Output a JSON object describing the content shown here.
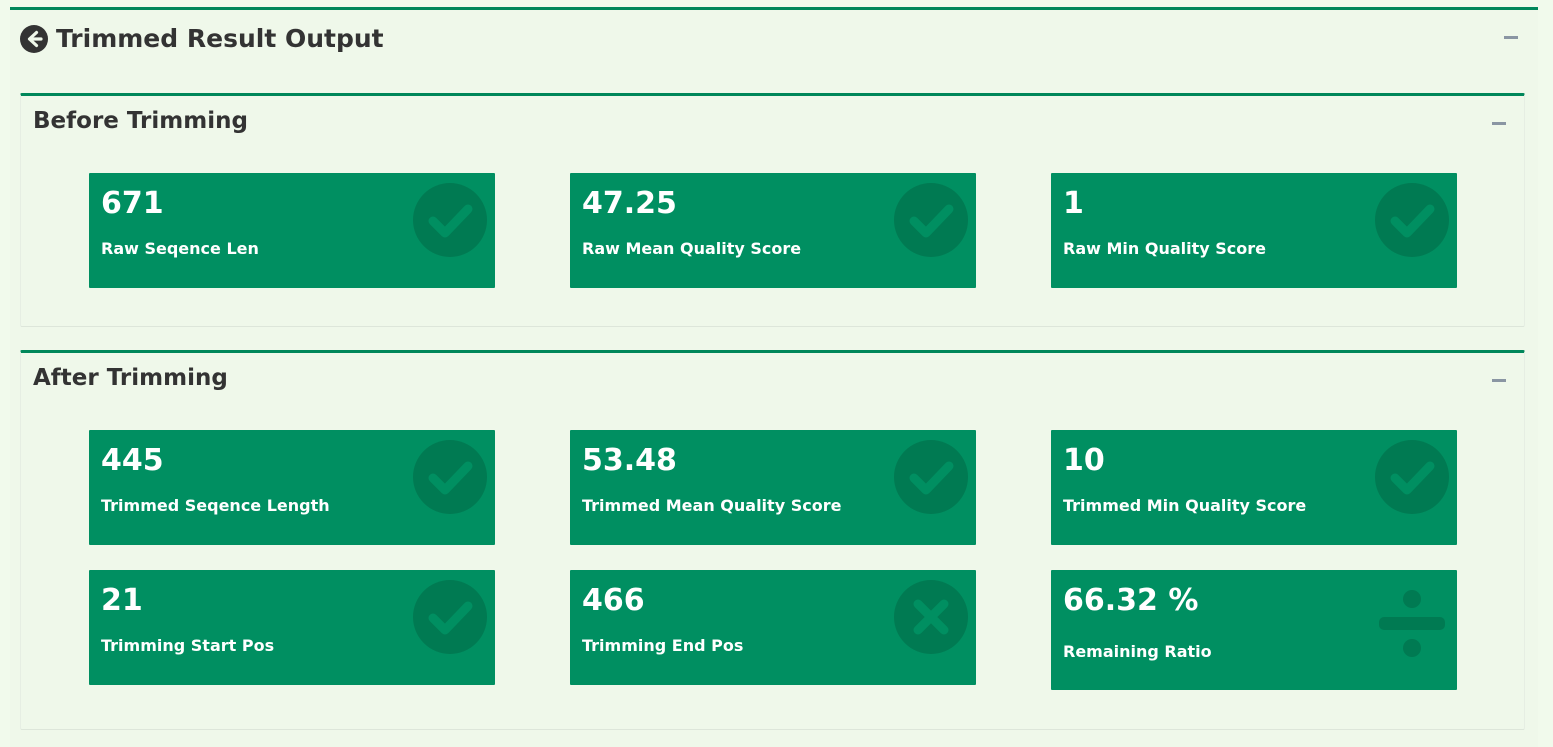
{
  "panel": {
    "title": "Trimmed Result Output",
    "back_icon": "arrow-circle-left-icon"
  },
  "before": {
    "title": "Before Trimming",
    "cards": [
      {
        "value": "671",
        "label": "Raw Seqence Len",
        "icon": "check-circle-icon"
      },
      {
        "value": "47.25",
        "label": "Raw Mean Quality Score",
        "icon": "check-circle-icon"
      },
      {
        "value": "1",
        "label": "Raw Min Quality Score",
        "icon": "check-circle-icon"
      }
    ]
  },
  "after": {
    "title": "After Trimming",
    "cards": [
      {
        "value": "445",
        "label": "Trimmed Seqence Length",
        "icon": "check-circle-icon"
      },
      {
        "value": "53.48",
        "label": "Trimmed Mean Quality Score",
        "icon": "check-circle-icon"
      },
      {
        "value": "10",
        "label": "Trimmed Min Quality Score",
        "icon": "check-circle-icon"
      },
      {
        "value": "21",
        "label": "Trimming Start Pos",
        "icon": "check-circle-icon"
      },
      {
        "value": "466",
        "label": "Trimming End Pos",
        "icon": "times-circle-icon"
      },
      {
        "value": "66.32 %",
        "label": "Remaining Ratio",
        "icon": "divide-icon"
      }
    ]
  },
  "colors": {
    "accent": "#00875a",
    "card_bg": "#008f61",
    "icon_fill": "#007a52",
    "page_bg": "#f1faec"
  }
}
